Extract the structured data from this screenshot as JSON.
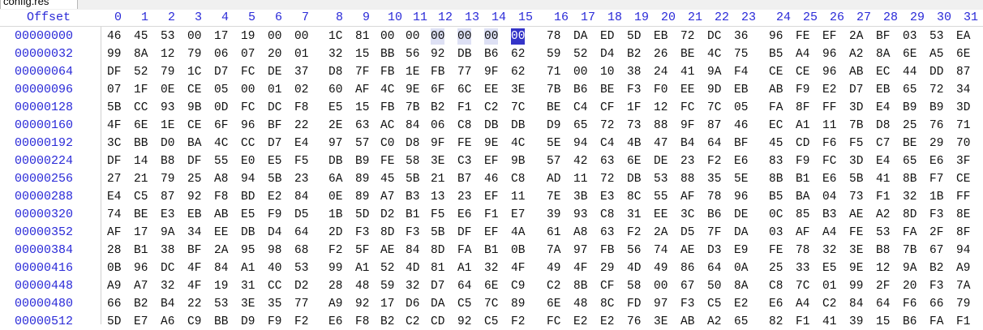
{
  "tab": {
    "label": "config.res"
  },
  "header": {
    "offset_label": "Offset",
    "columns": [
      "0",
      "1",
      "2",
      "3",
      "4",
      "5",
      "6",
      "7",
      "8",
      "9",
      "10",
      "11",
      "12",
      "13",
      "14",
      "15",
      "16",
      "17",
      "18",
      "19",
      "20",
      "21",
      "22",
      "23",
      "24",
      "25",
      "26",
      "27",
      "28",
      "29",
      "30",
      "31"
    ]
  },
  "colors": {
    "blue_text": "#2a2ad8",
    "selection": "#dde0f4",
    "caret": "#3434c8"
  },
  "selection": {
    "row": 0,
    "from": 12,
    "to": 15,
    "caret": 15
  },
  "rows": [
    {
      "offset": "00000000",
      "bytes": [
        "46",
        "45",
        "53",
        "00",
        "17",
        "19",
        "00",
        "00",
        "1C",
        "81",
        "00",
        "00",
        "00",
        "00",
        "00",
        "00",
        "78",
        "DA",
        "ED",
        "5D",
        "EB",
        "72",
        "DC",
        "36",
        "96",
        "FE",
        "EF",
        "2A",
        "BF",
        "03",
        "53",
        "EA"
      ]
    },
    {
      "offset": "00000032",
      "bytes": [
        "99",
        "8A",
        "12",
        "79",
        "06",
        "07",
        "20",
        "01",
        "32",
        "15",
        "BB",
        "56",
        "92",
        "DB",
        "B6",
        "62",
        "59",
        "52",
        "D4",
        "B2",
        "26",
        "BE",
        "4C",
        "75",
        "B5",
        "A4",
        "96",
        "A2",
        "8A",
        "6E",
        "A5",
        "6E"
      ]
    },
    {
      "offset": "00000064",
      "bytes": [
        "DF",
        "52",
        "79",
        "1C",
        "D7",
        "FC",
        "DE",
        "37",
        "D8",
        "7F",
        "FB",
        "1E",
        "FB",
        "77",
        "9F",
        "62",
        "71",
        "00",
        "10",
        "38",
        "24",
        "41",
        "9A",
        "F4",
        "CE",
        "CE",
        "96",
        "AB",
        "EC",
        "44",
        "DD",
        "87"
      ]
    },
    {
      "offset": "00000096",
      "bytes": [
        "07",
        "1F",
        "0E",
        "CE",
        "05",
        "00",
        "01",
        "02",
        "60",
        "AF",
        "4C",
        "9E",
        "6F",
        "6C",
        "EE",
        "3E",
        "7B",
        "B6",
        "BE",
        "F3",
        "F0",
        "EE",
        "9D",
        "EB",
        "AB",
        "F9",
        "E2",
        "D7",
        "EB",
        "65",
        "72",
        "34"
      ]
    },
    {
      "offset": "00000128",
      "bytes": [
        "5B",
        "CC",
        "93",
        "9B",
        "0D",
        "FC",
        "DC",
        "F8",
        "E5",
        "15",
        "FB",
        "7B",
        "B2",
        "F1",
        "C2",
        "7C",
        "BE",
        "C4",
        "CF",
        "1F",
        "12",
        "FC",
        "7C",
        "05",
        "FA",
        "8F",
        "FF",
        "3D",
        "E4",
        "B9",
        "B9",
        "3D"
      ]
    },
    {
      "offset": "00000160",
      "bytes": [
        "4F",
        "6E",
        "1E",
        "CE",
        "6F",
        "96",
        "BF",
        "22",
        "2E",
        "63",
        "AC",
        "84",
        "06",
        "C8",
        "DB",
        "DB",
        "D9",
        "65",
        "72",
        "73",
        "88",
        "9F",
        "87",
        "46",
        "EC",
        "A1",
        "11",
        "7B",
        "D8",
        "25",
        "76",
        "71"
      ]
    },
    {
      "offset": "00000192",
      "bytes": [
        "3C",
        "BB",
        "D0",
        "BA",
        "4C",
        "CC",
        "D7",
        "E4",
        "97",
        "57",
        "C0",
        "D8",
        "9F",
        "FE",
        "9E",
        "4C",
        "5E",
        "94",
        "C4",
        "4B",
        "47",
        "B4",
        "64",
        "BF",
        "45",
        "CD",
        "F6",
        "F5",
        "C7",
        "BE",
        "29",
        "70"
      ]
    },
    {
      "offset": "00000224",
      "bytes": [
        "DF",
        "14",
        "B8",
        "DF",
        "55",
        "E0",
        "E5",
        "F5",
        "DB",
        "B9",
        "FE",
        "58",
        "3E",
        "C3",
        "EF",
        "9B",
        "57",
        "42",
        "63",
        "6E",
        "DE",
        "23",
        "F2",
        "E6",
        "83",
        "F9",
        "FC",
        "3D",
        "E4",
        "65",
        "E6",
        "3F"
      ]
    },
    {
      "offset": "00000256",
      "bytes": [
        "27",
        "21",
        "79",
        "25",
        "A8",
        "94",
        "5B",
        "23",
        "6A",
        "89",
        "45",
        "5B",
        "21",
        "B7",
        "46",
        "C8",
        "AD",
        "11",
        "72",
        "DB",
        "53",
        "88",
        "35",
        "5E",
        "8B",
        "B1",
        "E6",
        "5B",
        "41",
        "8B",
        "F7",
        "CE"
      ]
    },
    {
      "offset": "00000288",
      "bytes": [
        "E4",
        "C5",
        "87",
        "92",
        "F8",
        "BD",
        "E2",
        "84",
        "0E",
        "89",
        "A7",
        "B3",
        "13",
        "23",
        "EF",
        "11",
        "7E",
        "3B",
        "E3",
        "8C",
        "55",
        "AF",
        "78",
        "96",
        "B5",
        "BA",
        "04",
        "73",
        "F1",
        "32",
        "1B",
        "FF"
      ]
    },
    {
      "offset": "00000320",
      "bytes": [
        "74",
        "BE",
        "E3",
        "EB",
        "AB",
        "E5",
        "F9",
        "D5",
        "1B",
        "5D",
        "D2",
        "B1",
        "F5",
        "E6",
        "F1",
        "E7",
        "39",
        "93",
        "C8",
        "31",
        "EE",
        "3C",
        "B6",
        "DE",
        "0C",
        "85",
        "B3",
        "AE",
        "A2",
        "8D",
        "F3",
        "8E"
      ]
    },
    {
      "offset": "00000352",
      "bytes": [
        "AF",
        "17",
        "9A",
        "34",
        "EE",
        "DB",
        "D4",
        "64",
        "2D",
        "F3",
        "8D",
        "F3",
        "5B",
        "DF",
        "EF",
        "4A",
        "61",
        "A8",
        "63",
        "F2",
        "2A",
        "D5",
        "7F",
        "DA",
        "03",
        "AF",
        "A4",
        "FE",
        "53",
        "FA",
        "2F",
        "8F"
      ]
    },
    {
      "offset": "00000384",
      "bytes": [
        "28",
        "B1",
        "38",
        "BF",
        "2A",
        "95",
        "98",
        "68",
        "F2",
        "5F",
        "AE",
        "84",
        "8D",
        "FA",
        "B1",
        "0B",
        "7A",
        "97",
        "FB",
        "56",
        "74",
        "AE",
        "D3",
        "E9",
        "FE",
        "78",
        "32",
        "3E",
        "B8",
        "7B",
        "67",
        "94"
      ]
    },
    {
      "offset": "00000416",
      "bytes": [
        "0B",
        "96",
        "DC",
        "4F",
        "84",
        "A1",
        "40",
        "53",
        "99",
        "A1",
        "52",
        "4D",
        "81",
        "A1",
        "32",
        "4F",
        "49",
        "4F",
        "29",
        "4D",
        "49",
        "86",
        "64",
        "0A",
        "25",
        "33",
        "E5",
        "9E",
        "12",
        "9A",
        "B2",
        "A9"
      ]
    },
    {
      "offset": "00000448",
      "bytes": [
        "A9",
        "A7",
        "32",
        "4F",
        "19",
        "31",
        "CC",
        "D2",
        "28",
        "48",
        "59",
        "32",
        "D7",
        "64",
        "6E",
        "C9",
        "C2",
        "8B",
        "CF",
        "58",
        "00",
        "67",
        "50",
        "8A",
        "C8",
        "7C",
        "01",
        "99",
        "2F",
        "20",
        "F3",
        "7A"
      ]
    },
    {
      "offset": "00000480",
      "bytes": [
        "66",
        "B2",
        "B4",
        "22",
        "53",
        "3E",
        "35",
        "77",
        "A9",
        "92",
        "17",
        "D6",
        "DA",
        "C5",
        "7C",
        "89",
        "6E",
        "48",
        "8C",
        "FD",
        "97",
        "F3",
        "C5",
        "E2",
        "E6",
        "A4",
        "C2",
        "84",
        "64",
        "F6",
        "66",
        "79"
      ]
    },
    {
      "offset": "00000512",
      "bytes": [
        "5D",
        "E7",
        "A6",
        "C9",
        "BB",
        "D9",
        "F9",
        "F2",
        "E6",
        "F8",
        "B2",
        "C2",
        "CD",
        "92",
        "C5",
        "F2",
        "FC",
        "E2",
        "E2",
        "76",
        "3E",
        "AB",
        "A2",
        "65",
        "82",
        "F1",
        "41",
        "39",
        "15",
        "B6",
        "FA",
        "F1"
      ]
    }
  ]
}
